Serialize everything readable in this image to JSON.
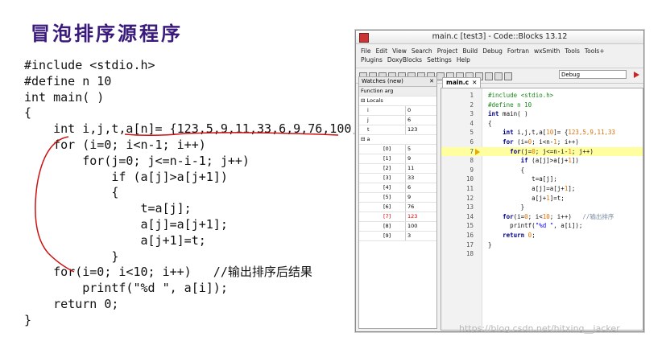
{
  "slide": {
    "title": "冒泡排序源程序"
  },
  "code": [
    "#include <stdio.h>",
    "#define n 10",
    "int main( )",
    "{",
    "    int i,j,t,a[n]= {123,5,9,11,33,6,9,76,100,3};",
    "    for (i=0; i<n-1; i++)",
    "        for(j=0; j<=n-i-1; j++)",
    "            if (a[j]>a[j+1])",
    "            {",
    "                t=a[j];",
    "                a[j]=a[j+1];",
    "                a[j+1]=t;",
    "            }",
    "    for(i=0; i<10; i++)   //输出排序后结果",
    "        printf(\"%d \", a[i]);",
    "    return 0;",
    "}"
  ],
  "window": {
    "title": "main.c [test3] - Code::Blocks 13.12",
    "menu_row1": [
      "File",
      "Edit",
      "View",
      "Search",
      "Project",
      "Build",
      "Debug",
      "Fortran",
      "wxSmith",
      "Tools",
      "Tools+"
    ],
    "menu_row2": [
      "Plugins",
      "DoxyBlocks",
      "Settings",
      "Help"
    ],
    "build_target": "Debug"
  },
  "watches": {
    "title": "Watches (new)",
    "close": "✕",
    "header": "Function arg",
    "locals_label": "Locals",
    "locals": [
      {
        "name": "i",
        "value": "0"
      },
      {
        "name": "j",
        "value": "6"
      },
      {
        "name": "t",
        "value": "123"
      }
    ],
    "array_label": "a",
    "array": [
      {
        "name": "[0]",
        "value": "5"
      },
      {
        "name": "[1]",
        "value": "9"
      },
      {
        "name": "[2]",
        "value": "11"
      },
      {
        "name": "[3]",
        "value": "33"
      },
      {
        "name": "[4]",
        "value": "6"
      },
      {
        "name": "[5]",
        "value": "9"
      },
      {
        "name": "[6]",
        "value": "76"
      },
      {
        "name": "[7]",
        "value": "123"
      },
      {
        "name": "[8]",
        "value": "100"
      },
      {
        "name": "[9]",
        "value": "3"
      }
    ],
    "highlight_color": "#dd0000"
  },
  "editor": {
    "tab_label": "main.c",
    "tab_close": "✕",
    "current_line": 7,
    "lines": [
      {
        "num": "1",
        "html": "<span class='pp'>#include &lt;stdio.h&gt;</span>"
      },
      {
        "num": "2",
        "html": "<span class='pp'>#define n 10</span>"
      },
      {
        "num": "3",
        "html": "<span class='kw'>int</span> main( )"
      },
      {
        "num": "4",
        "html": "{"
      },
      {
        "num": "5",
        "html": "    <span class='kw'>int</span> i,j,t,a[<span class='num'>10</span>]= {<span class='num'>123,5,9,11,33</span>"
      },
      {
        "num": "6",
        "html": "    <span class='kw'>for</span> (i=<span class='num'>0</span>; i&lt;n-<span class='num'>1</span>; i++)"
      },
      {
        "num": "7",
        "html": "      <span class='kw'>for</span>(j=<span class='num'>0</span>; j&lt;=n-i-<span class='num'>1</span>; j++)"
      },
      {
        "num": "8",
        "html": "         <span class='kw'>if</span> (a[j]&gt;a[j+<span class='num'>1</span>])"
      },
      {
        "num": "9",
        "html": "         {"
      },
      {
        "num": "10",
        "html": "            t=a[j];"
      },
      {
        "num": "11",
        "html": "            a[j]=a[j+<span class='num'>1</span>];"
      },
      {
        "num": "12",
        "html": "            a[j+<span class='num'>1</span>]=t;"
      },
      {
        "num": "13",
        "html": "         }"
      },
      {
        "num": "14",
        "html": "    <span class='kw'>for</span>(i=<span class='num'>0</span>; i&lt;<span class='num'>10</span>; i++)   <span class='cm'>//输出排序</span>"
      },
      {
        "num": "15",
        "html": "      printf(<span class='str'>\"%d \"</span>, a[i]);"
      },
      {
        "num": "16",
        "html": "    <span class='kw'>return</span> <span class='num'>0</span>;"
      },
      {
        "num": "17",
        "html": "}"
      },
      {
        "num": "18",
        "html": ""
      }
    ]
  },
  "watermark": "https://blog.csdn.net/hitxing__jacker",
  "colors": {
    "annotation": "#cc1111",
    "title": "#3a1a7a"
  }
}
